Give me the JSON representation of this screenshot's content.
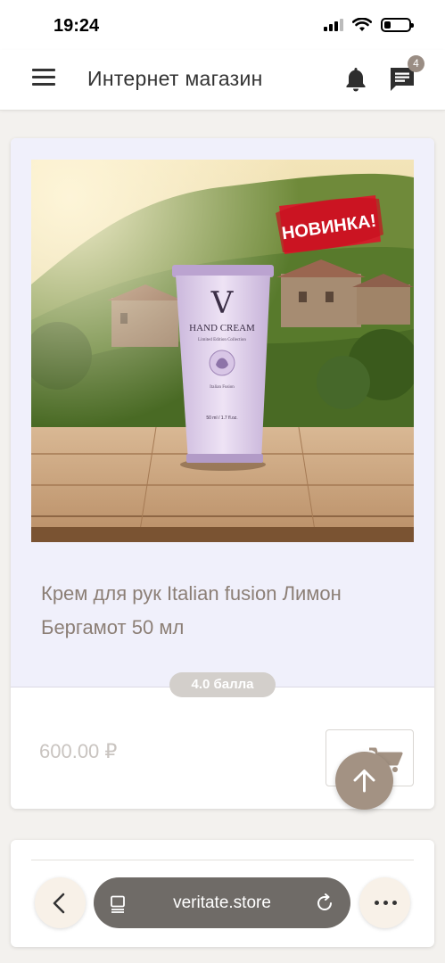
{
  "status_bar": {
    "time": "19:24",
    "battery_level": 0.25
  },
  "header": {
    "title": "Интернет магазин",
    "menu_icon": "hamburger-menu-icon",
    "notification_icon": "bell-icon",
    "messages_icon": "chat-icon",
    "messages_count": "4"
  },
  "product": {
    "name": "Крем для рук Italian fusion Лимон Бергамот 50 мл",
    "rating": "4.0 балла",
    "price": "600.00 ₽",
    "cart_icon": "cart-icon",
    "image": {
      "sticker_text": "НОВИНКА!",
      "brand_mark": "V",
      "product_label": "HAND CREAM",
      "product_sublabel": "Limited Edition Collection",
      "product_small_text": "Italian Fusion",
      "volume_text": "50 ml / 1.7 fl.oz."
    }
  },
  "scroll_top_icon": "arrow-up-icon",
  "browser": {
    "url": "veritate.store",
    "back_icon": "chevron-left-icon",
    "tabs_icon": "tabs-icon",
    "reload_icon": "reload-icon",
    "more_icon": "more-dots-icon"
  },
  "colors": {
    "accent": "#a39283",
    "card_background": "#f0f0fb",
    "badge": "#d3cfcb",
    "name_text": "#8c7f76",
    "sticker_red": "#d7192a"
  }
}
